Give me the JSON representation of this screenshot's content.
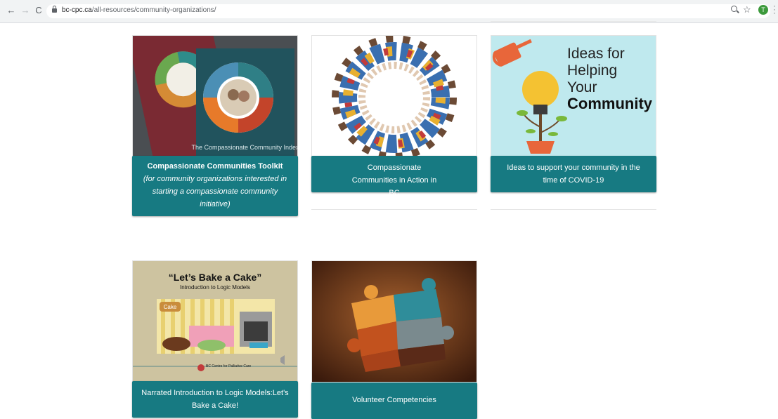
{
  "browser": {
    "url_domain": "bc-cpc.ca",
    "url_path": "/all-resources/community-organizations/",
    "profile_initial": "T",
    "icons": [
      "back-icon",
      "forward-icon",
      "reload-icon",
      "lock-icon",
      "zoom-icon",
      "star-icon",
      "menu-icon"
    ]
  },
  "cards": [
    {
      "title": "Compassionate Communities Toolkit",
      "subtitle": "(for community organizations interested in starting a compassionate community initiative)",
      "image_text": "The Compassionate Community Index"
    },
    {
      "title": "Compassionate Communities in Action in BC"
    },
    {
      "title": "Ideas to support your community in the time of COVID-19",
      "image_lines": [
        "Ideas for",
        "Helping",
        "Your",
        "Community"
      ]
    },
    {
      "title": "Narrated Introduction to Logic Models:Let's Bake a Cake!",
      "image_title": "“Let’s Bake a Cake”",
      "image_subtitle": "Introduction to Logic Models",
      "image_cake_word": "Cake",
      "image_logo_text": "BC Centre for Palliative Care"
    },
    {
      "title": "Volunteer Competencies"
    }
  ],
  "colors": {
    "button_teal": "#177a82",
    "chrome_bg": "#f1f3f4"
  }
}
